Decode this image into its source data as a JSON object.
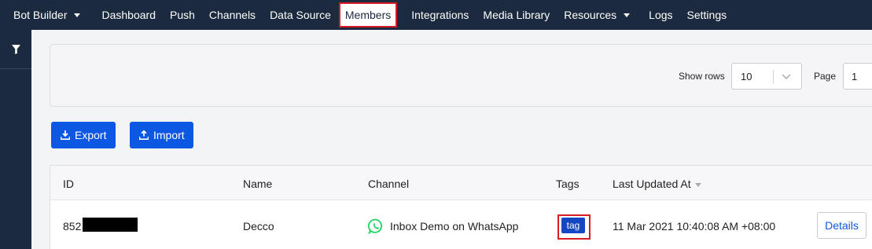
{
  "nav": {
    "items": [
      {
        "label": "Bot Builder",
        "dropdown": true
      },
      {
        "label": "Dashboard"
      },
      {
        "label": "Push"
      },
      {
        "label": "Channels"
      },
      {
        "label": "Data Source"
      },
      {
        "label": "Members",
        "active": true
      },
      {
        "label": "Integrations"
      },
      {
        "label": "Media Library"
      },
      {
        "label": "Resources",
        "dropdown": true
      },
      {
        "label": "Logs"
      },
      {
        "label": "Settings"
      }
    ]
  },
  "sidebar": {
    "icon": "filter-icon"
  },
  "filters": {
    "show_rows_label": "Show rows",
    "show_rows_value": "10",
    "page_label": "Page",
    "page_value": "1"
  },
  "actions": {
    "export_label": "Export",
    "import_label": "Import"
  },
  "table": {
    "headers": [
      "ID",
      "Name",
      "Channel",
      "Tags",
      "Last Updated At"
    ],
    "rows": [
      {
        "id_prefix": "852",
        "name": "Decco",
        "channel": "Inbox Demo on WhatsApp",
        "channel_icon": "whatsapp-icon",
        "tag": "tag",
        "last_updated": "11 Mar 2021 10:40:08 AM +08:00",
        "details_label": "Details"
      }
    ]
  },
  "colors": {
    "nav_bg": "#1b2a3e",
    "primary": "#0c58e3",
    "highlight": "#d81b25",
    "whatsapp": "#25d366"
  }
}
